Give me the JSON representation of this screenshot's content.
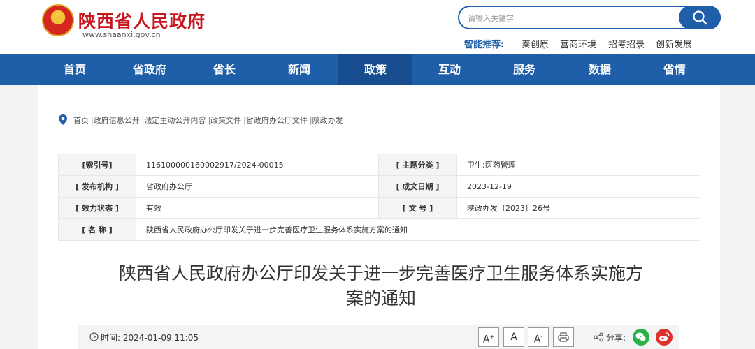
{
  "header": {
    "site_title": "陕西省人民政府",
    "site_url": "www.shaanxi.gov.cn",
    "search": {
      "placeholder": "请输入关键字"
    },
    "smart": {
      "label": "智能推荐:",
      "items": [
        "秦创原",
        "营商环境",
        "招考招录",
        "创新发展"
      ]
    }
  },
  "nav": {
    "items": [
      "首页",
      "省政府",
      "省长",
      "新闻",
      "政策",
      "互动",
      "服务",
      "数据",
      "省情"
    ],
    "active": "政策"
  },
  "breadcrumb": {
    "items": [
      "首页",
      "政府信息公开",
      "法定主动公开内容",
      "政策文件",
      "省政府办公厅文件",
      "陕政办发"
    ],
    "separator": "|"
  },
  "meta": {
    "index_key": "[索引号]",
    "index_value": "116100000160002917/2024-00015",
    "topic_key": "[ 主题分类 ]",
    "topic_value": "卫生;医药管理",
    "org_key": "[ 发布机构 ]",
    "org_value": "省政府办公厅",
    "date_key": "[ 成文日期 ]",
    "date_value": "2023-12-19",
    "status_key": "[ 效力状态 ]",
    "status_value": "有效",
    "docno_key": "[ 文 号 ]",
    "docno_value": "陕政办发〔2023〕26号",
    "name_key": "[ 名 称 ]",
    "name_value": "陕西省人民政府办公厅印发关于进一步完善医疗卫生服务体系实施方案的通知"
  },
  "article": {
    "title_line1": "陕西省人民政府办公厅印发关于进一步完善医疗卫生服务体系实施方",
    "title_line2": "案的通知"
  },
  "toolbar": {
    "time_label": "时间:",
    "time_value": "2024-01-09 11:05",
    "font_larger": "A",
    "font_normal": "A",
    "font_smaller": "A",
    "share_label": "分享:"
  },
  "colors": {
    "brand_blue": "#1f5ea8",
    "brand_red": "#c8161e",
    "wechat_green": "#2bb24a",
    "weibo_red": "#e0302b"
  }
}
